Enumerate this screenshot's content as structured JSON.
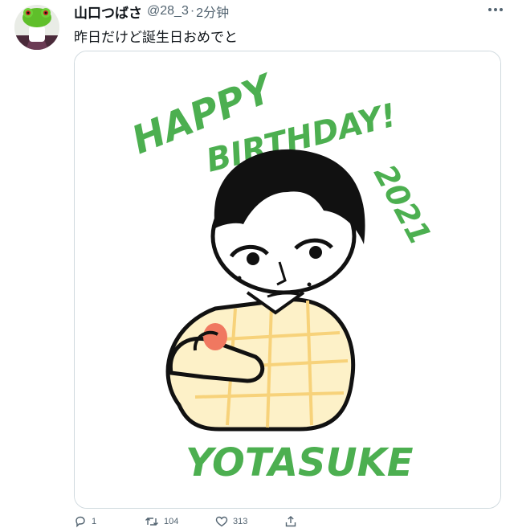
{
  "tweet": {
    "display_name": "山口つばさ",
    "handle": "@28_3",
    "separator": "·",
    "time": "2分钟",
    "text": "昨日だけど誕生日おめでと",
    "more_icon": "more-icon"
  },
  "media": {
    "lettering": [
      "HAPPY",
      "BIRTHDAY!",
      "2021",
      "YOTASUKE"
    ],
    "colors": {
      "green": "#4caf50",
      "sweater": "#fdf1c8",
      "sweater_lines": "#f7d27a",
      "apple": "#f07860",
      "ink": "#111111"
    }
  },
  "actions": {
    "reply": {
      "icon": "reply-icon",
      "count": "1"
    },
    "retweet": {
      "icon": "retweet-icon",
      "count": "104"
    },
    "like": {
      "icon": "heart-icon",
      "count": "313"
    },
    "share": {
      "icon": "share-icon",
      "count": ""
    }
  }
}
